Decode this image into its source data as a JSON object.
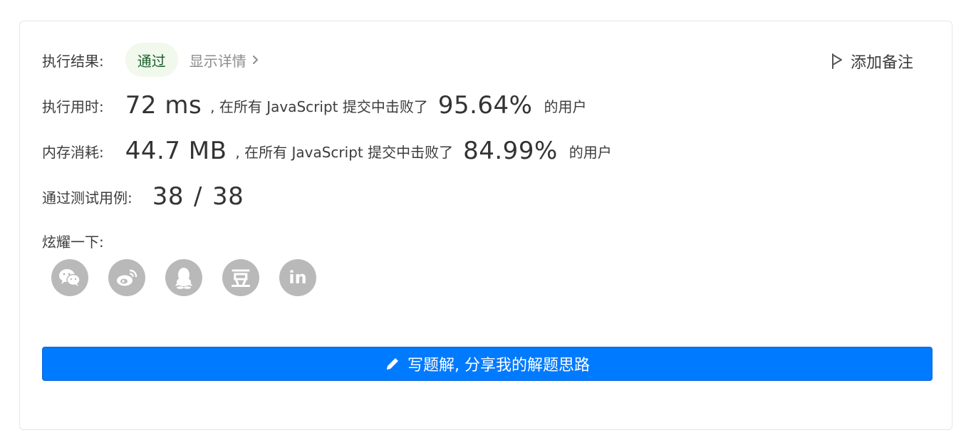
{
  "result": {
    "label": "执行结果:",
    "status": "通过",
    "detail_link": "显示详情"
  },
  "note_button": "添加备注",
  "runtime": {
    "label": "执行用时:",
    "value": "72 ms",
    "mid_text": ", 在所有 JavaScript 提交中击败了",
    "percent": "95.64%",
    "suffix": "的用户"
  },
  "memory": {
    "label": "内存消耗:",
    "value": "44.7 MB",
    "mid_text": ", 在所有 JavaScript 提交中击败了",
    "percent": "84.99%",
    "suffix": "的用户"
  },
  "tests": {
    "label": "通过测试用例:",
    "passed": "38",
    "separator": "/",
    "total": "38"
  },
  "share": {
    "label": "炫耀一下:",
    "icons": [
      "wechat-icon",
      "weibo-icon",
      "qq-icon",
      "douban-icon",
      "linkedin-icon"
    ],
    "douban_glyph": "豆",
    "linkedin_glyph": "in"
  },
  "write_button": "写题解, 分享我的解题思路",
  "colors": {
    "primary": "#007aff",
    "success_bg": "#f1f8ec",
    "success_text": "#1a5f2a",
    "icon_gray": "#b9b9b9"
  }
}
